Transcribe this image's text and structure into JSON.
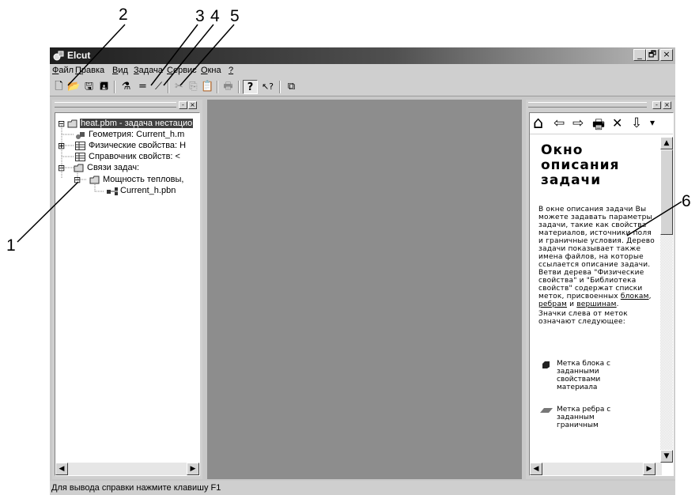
{
  "callouts": [
    "1",
    "2",
    "3",
    "4",
    "5",
    "6"
  ],
  "window": {
    "title": "Elcut",
    "controls": [
      "_",
      "🗗",
      "×"
    ]
  },
  "menu": [
    {
      "key": "Ф",
      "rest": "айл"
    },
    {
      "key": "П",
      "rest": "равка"
    },
    {
      "key": "В",
      "rest": "ид"
    },
    {
      "key": "З",
      "rest": "адача"
    },
    {
      "key": "С",
      "rest": "ервис"
    },
    {
      "key": "О",
      "rest": "кна"
    },
    {
      "key": "?",
      "rest": ""
    }
  ],
  "toolbar": {
    "icons": [
      "new-document-icon",
      "open-folder-icon",
      "save-icon",
      "save-all-icon",
      "geometry-model-icon",
      "equals-icon",
      "wand-icon",
      "cut-icon",
      "copy-icon",
      "paste-icon",
      "print-icon",
      "help-icon",
      "context-help-icon",
      "windows-icon"
    ],
    "glyphs": {
      "new": "🗋",
      "open": "📂",
      "save": "🖫",
      "saveall": "🖪",
      "model": "⚗",
      "equals": "=",
      "wand": "⟋",
      "cut": "✂",
      "copy": "⎘",
      "paste": "📋",
      "print": "🖶",
      "help": "?",
      "ctxhelp": "↖?",
      "windows": "⧉"
    }
  },
  "tree": {
    "items": [
      {
        "label": "heat.pbm - задача нестацио",
        "expander": "⊟",
        "icon": "folder-open-icon",
        "selected": true
      },
      {
        "label": "Геометрия: Current_h.m",
        "expander": "",
        "icon": "geometry-icon"
      },
      {
        "label": "Физические свойства: H",
        "expander": "⊞",
        "icon": "table-icon"
      },
      {
        "label": "Справочник свойств: <",
        "expander": "",
        "icon": "table-icon"
      },
      {
        "label": "Связи задач:",
        "expander": "⊟",
        "icon": "folder-open-icon"
      },
      {
        "label": "Мощность тепловы,",
        "expander": "⊟",
        "icon": "folder-open-icon"
      },
      {
        "label": "Current_h.pbn",
        "expander": "",
        "icon": "link-icon"
      }
    ]
  },
  "help": {
    "toolbar_glyphs": {
      "home": "⌂",
      "back": "⇦",
      "forward": "⇨",
      "print": "🖶",
      "close": "✕",
      "download": "⇩",
      "more": "▾"
    },
    "title": "Окно описания задачи",
    "body_start": "В окне описания задачи Вы можете задавать параметры задачи, такие как свойства материалов, источники поля и граничные условия. Дерево задачи показывает также имена файлов, на которые ссылается описание задачи. Ветви дерева \"Физические свойства\" и \"Библиотека свойств\" содержат списки меток, присвоенных ",
    "link_blocks": "блокам",
    "comma": ", ",
    "link_edges": "ребрам",
    "and": " и ",
    "link_vertices": "вершинам",
    "period": ".",
    "icons_note": "Значки слева от меток означают следующее:",
    "bullets": [
      {
        "icon": "block-label-icon",
        "text": "Метка блока с заданными свойствами материала"
      },
      {
        "icon": "edge-label-icon",
        "text": "Метка ребра с заданным граничным"
      }
    ]
  },
  "status": "Для вывода справки нажмите клавишу F1"
}
